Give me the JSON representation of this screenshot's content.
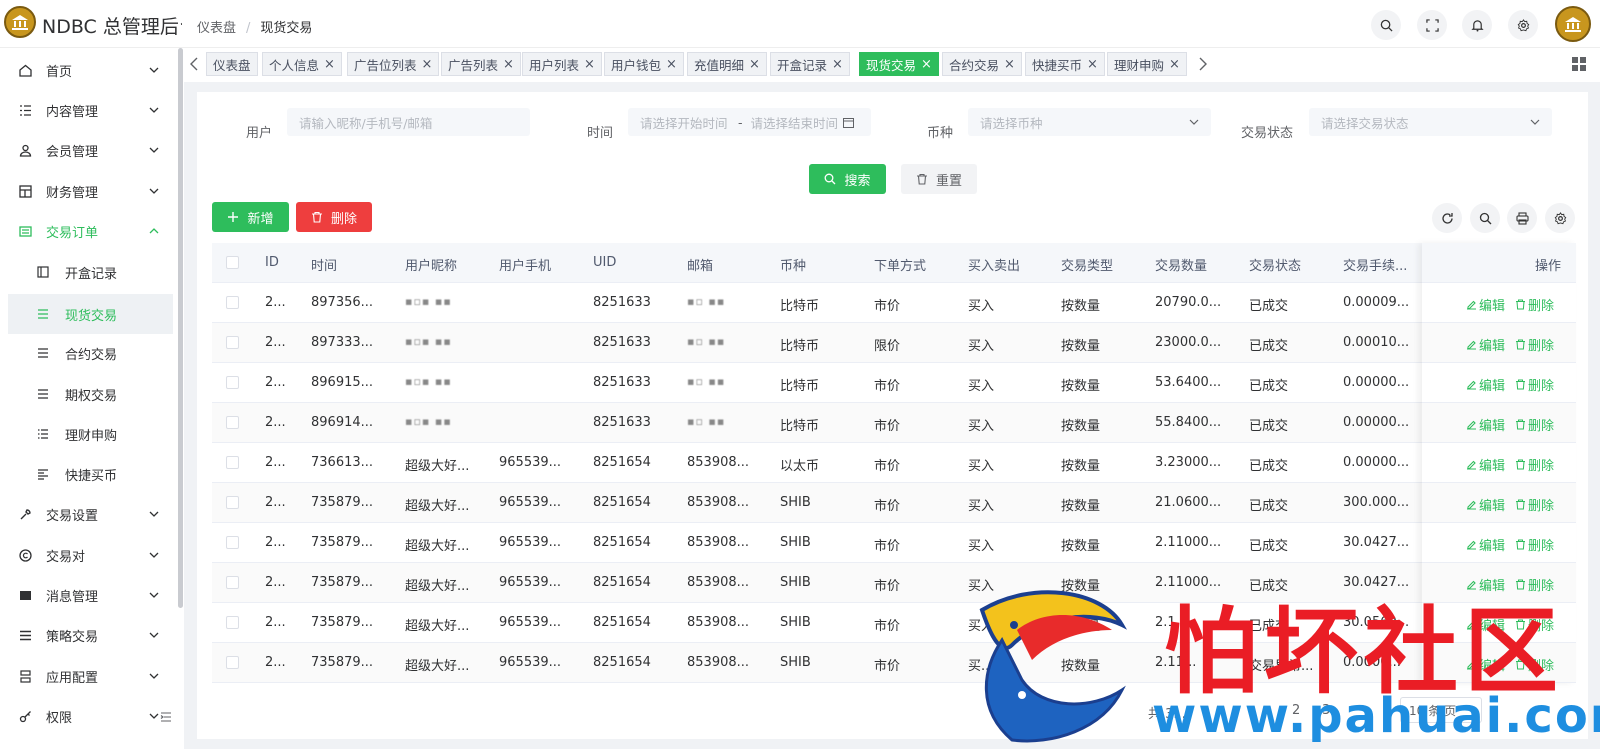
{
  "header": {
    "app_title": "NDBC 总管理后台",
    "breadcrumb": [
      "仪表盘",
      "现货交易"
    ]
  },
  "sidebar": {
    "items": [
      {
        "label": "首页",
        "icon": "home-icon",
        "expandable": true
      },
      {
        "label": "内容管理",
        "icon": "list-icon",
        "expandable": true
      },
      {
        "label": "会员管理",
        "icon": "user-icon",
        "expandable": true
      },
      {
        "label": "财务管理",
        "icon": "table-icon",
        "expandable": true
      },
      {
        "label": "交易订单",
        "icon": "order-icon",
        "expandable": true,
        "expanded": true
      },
      {
        "label": "开盒记录",
        "icon": "box-icon",
        "sub": true
      },
      {
        "label": "现货交易",
        "icon": "list-icon",
        "sub": true,
        "active": true
      },
      {
        "label": "合约交易",
        "icon": "list-icon",
        "sub": true
      },
      {
        "label": "期权交易",
        "icon": "list-icon",
        "sub": true
      },
      {
        "label": "理财申购",
        "icon": "list-icon",
        "sub": true
      },
      {
        "label": "快捷买币",
        "icon": "align-icon",
        "sub": true
      },
      {
        "label": "交易设置",
        "icon": "wrench-icon",
        "expandable": true
      },
      {
        "label": "交易对",
        "icon": "copyright-icon",
        "expandable": true
      },
      {
        "label": "消息管理",
        "icon": "message-icon",
        "expandable": true
      },
      {
        "label": "策略交易",
        "icon": "menu-icon",
        "expandable": true
      },
      {
        "label": "应用配置",
        "icon": "config-icon",
        "expandable": true
      },
      {
        "label": "权限",
        "icon": "key-icon",
        "expandable": true
      }
    ]
  },
  "tabs": [
    {
      "label": "仪表盘",
      "closable": false
    },
    {
      "label": "个人信息",
      "closable": true
    },
    {
      "label": "广告位列表",
      "closable": true
    },
    {
      "label": "广告列表",
      "closable": true
    },
    {
      "label": "用户列表",
      "closable": true
    },
    {
      "label": "用户钱包",
      "closable": true
    },
    {
      "label": "充值明细",
      "closable": true
    },
    {
      "label": "开盒记录",
      "closable": true
    },
    {
      "label": "现货交易",
      "closable": true,
      "active": true
    },
    {
      "label": "合约交易",
      "closable": true
    },
    {
      "label": "快捷买币",
      "closable": true
    },
    {
      "label": "理财申购",
      "closable": true
    }
  ],
  "filters": {
    "user_label": "用户",
    "user_placeholder": "请输入昵称/手机号/邮箱",
    "time_label": "时间",
    "time_start_placeholder": "请选择开始时间",
    "time_sep": "-",
    "time_end_placeholder": "请选择结束时间",
    "coin_label": "币种",
    "coin_placeholder": "请选择币种",
    "status_label": "交易状态",
    "status_placeholder": "请选择交易状态",
    "search_button": "搜索",
    "reset_button": "重置"
  },
  "toolbar": {
    "add_button": "新增",
    "delete_button": "删除"
  },
  "table": {
    "columns": [
      "ID",
      "时间",
      "用户昵称",
      "用户手机",
      "UID",
      "邮箱",
      "币种",
      "下单方式",
      "买入卖出",
      "交易类型",
      "交易数量",
      "交易状态",
      "交易手续...",
      "操作"
    ],
    "rows": [
      [
        "2...",
        "897356...",
        "",
        "",
        "8251633",
        "",
        "比特币",
        "市价",
        "买入",
        "按数量",
        "20790.0...",
        "已成交",
        "0.00009..."
      ],
      [
        "2...",
        "897333...",
        "",
        "",
        "8251633",
        "",
        "比特币",
        "限价",
        "买入",
        "按数量",
        "23000.0...",
        "已成交",
        "0.00010..."
      ],
      [
        "2...",
        "896915...",
        "",
        "",
        "8251633",
        "",
        "比特币",
        "市价",
        "买入",
        "按数量",
        "53.6400...",
        "已成交",
        "0.00000..."
      ],
      [
        "2...",
        "896914...",
        "",
        "",
        "8251633",
        "",
        "比特币",
        "市价",
        "买入",
        "按数量",
        "55.8400...",
        "已成交",
        "0.00000..."
      ],
      [
        "2...",
        "736613...",
        "超级大好...",
        "965539...",
        "8251654",
        "853908...",
        "以太币",
        "市价",
        "买入",
        "按数量",
        "3.23000...",
        "已成交",
        "0.00000..."
      ],
      [
        "2...",
        "735879...",
        "超级大好...",
        "965539...",
        "8251654",
        "853908...",
        "SHIB",
        "市价",
        "买入",
        "按数量",
        "21.0600...",
        "已成交",
        "300.000..."
      ],
      [
        "2...",
        "735879...",
        "超级大好...",
        "965539...",
        "8251654",
        "853908...",
        "SHIB",
        "市价",
        "买入",
        "按数量",
        "2.11000...",
        "已成交",
        "30.0427..."
      ],
      [
        "2...",
        "735879...",
        "超级大好...",
        "965539...",
        "8251654",
        "853908...",
        "SHIB",
        "市价",
        "买入",
        "按数量",
        "2.11000...",
        "已成交",
        "30.0427..."
      ],
      [
        "2...",
        "735879...",
        "超级大好...",
        "965539...",
        "8251654",
        "853908...",
        "SHIB",
        "市价",
        "买入",
        "按数量",
        "2.1...",
        "已成交",
        "30.0569..."
      ],
      [
        "2...",
        "735879...",
        "超级大好...",
        "965539...",
        "8251654",
        "853908...",
        "SHIB",
        "市价",
        "买...",
        "按数量",
        "2.11...",
        "交易异常...",
        "0.0000..."
      ]
    ],
    "edit_label": "编辑",
    "delete_label": "删除"
  },
  "pagination": {
    "total_text": "共 3...",
    "pages": [
      "2",
      "3"
    ],
    "page_size": "10 条/页"
  },
  "watermark": {
    "text": "怕坏社区",
    "url": "www.pahuai.com"
  },
  "colors": {
    "accent": "#2ebd5c",
    "danger": "#ee3e3e",
    "watermark_red": "#ea1d25",
    "watermark_blue": "#1e8ee0"
  }
}
